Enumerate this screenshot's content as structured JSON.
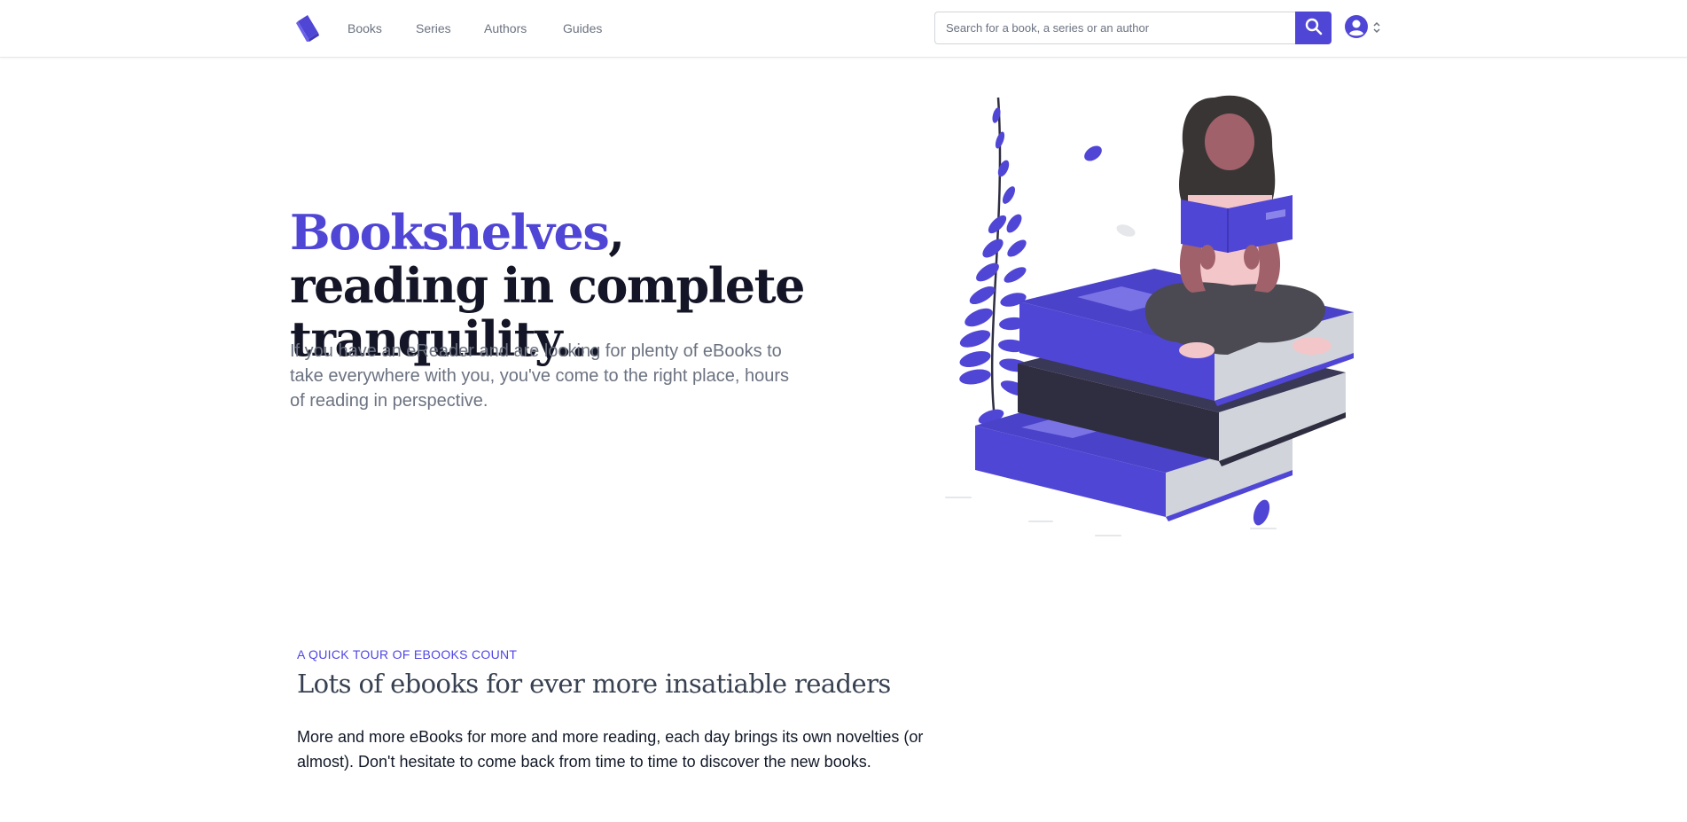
{
  "header": {
    "logo_icon": "book-logo-icon",
    "nav": [
      {
        "label": "Books"
      },
      {
        "label": "Series"
      },
      {
        "label": "Authors"
      },
      {
        "label": "Guides"
      }
    ],
    "search": {
      "placeholder": "Search for a book, a series or an author",
      "value": "",
      "button_icon": "search-icon"
    },
    "user_icon": "user-circle-icon",
    "user_chevron_icon": "chevron-up-down-icon"
  },
  "hero": {
    "title_accent": "Bookshelves",
    "title_rest": ", reading in complete tranquility...",
    "text": "If you have an eReader and are looking for plenty of eBooks to take everywhere with you, you've come to the right place, hours of reading in perspective.",
    "illustration": "woman-reading-on-books-illustration"
  },
  "section": {
    "eyebrow": "A QUICK TOUR OF EBOOKS COUNT",
    "title": "Lots of ebooks for ever more insatiable readers",
    "text": "More and more eBooks for more and more reading, each day brings its own novelties (or almost). Don't hesitate to come back from time to time to discover the new books."
  },
  "colors": {
    "accent": "#5046d6",
    "dark_book": "#2f2e41",
    "text_dark": "#141526",
    "text_muted": "#6b7280"
  }
}
